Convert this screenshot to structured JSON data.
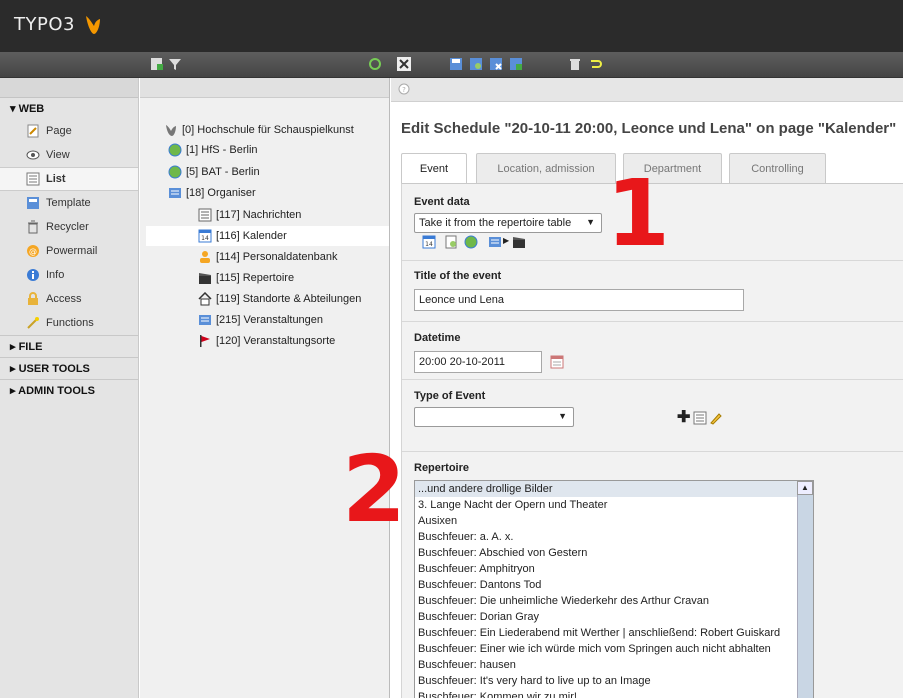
{
  "app": {
    "logo_text": "TYPO3"
  },
  "module_menu": {
    "sections": [
      {
        "label": "▾ WEB",
        "items": [
          {
            "label": "Page",
            "icon": "page-icon"
          },
          {
            "label": "View",
            "icon": "eye-icon"
          },
          {
            "label": "List",
            "icon": "list-icon",
            "active": true
          },
          {
            "label": "Template",
            "icon": "template-icon"
          },
          {
            "label": "Recycler",
            "icon": "trash-icon"
          },
          {
            "label": "Powermail",
            "icon": "powermail-icon"
          },
          {
            "label": "Info",
            "icon": "info-icon"
          },
          {
            "label": "Access",
            "icon": "lock-icon"
          },
          {
            "label": "Functions",
            "icon": "wand-icon"
          }
        ]
      },
      {
        "label": "▸ FILE"
      },
      {
        "label": "▸ USER TOOLS"
      },
      {
        "label": "▸ ADMIN TOOLS"
      }
    ]
  },
  "page_tree": {
    "nodes": [
      {
        "label": "[0] Hochschule für Schauspielkunst"
      },
      {
        "label": "[1] HfS - Berlin"
      },
      {
        "label": "[5] BAT - Berlin"
      },
      {
        "label": "[18] Organiser"
      },
      {
        "label": "[117] Nachrichten"
      },
      {
        "label": "[116] Kalender"
      },
      {
        "label": "[114] Personaldatenbank"
      },
      {
        "label": "[115] Repertoire"
      },
      {
        "label": "[119] Standorte & Abteilungen"
      },
      {
        "label": "[215] Veranstaltungen"
      },
      {
        "label": "[120] Veranstaltungsorte"
      }
    ]
  },
  "editor": {
    "title": "Edit Schedule \"20-10-11 20:00, Leonce und Lena\" on page \"Kalender\"",
    "tabs": [
      "Event",
      "Location, admission",
      "Department",
      "Controlling"
    ],
    "event_data": {
      "label": "Event data",
      "select_value": "Take it from the repertoire table"
    },
    "title_of_event": {
      "label": "Title of the event",
      "value": "Leonce und Lena"
    },
    "datetime": {
      "label": "Datetime",
      "value": "20:00 20-10-2011"
    },
    "type_of_event": {
      "label": "Type of Event",
      "select_value": ""
    },
    "repertoire": {
      "label": "Repertoire",
      "items": [
        "...und andere drollige Bilder",
        "3. Lange Nacht der Opern und Theater",
        "Ausixen",
        "Buschfeuer: a. A. x.",
        "Buschfeuer: Abschied von Gestern",
        "Buschfeuer: Amphitryon",
        "Buschfeuer: Dantons Tod",
        "Buschfeuer: Die unheimliche Wiederkehr des Arthur Cravan",
        "Buschfeuer: Dorian Gray",
        "Buschfeuer: Ein Liederabend mit Werther | anschließend: Robert Guiskard",
        "Buschfeuer: Einer wie ich würde mich vom Springen auch nicht abhalten",
        "Buschfeuer: hausen",
        "Buschfeuer: It's very hard to live up to an Image",
        "Buschfeuer: Kommen wir zu mir!"
      ]
    }
  },
  "annotations": {
    "one": "1",
    "two": "2"
  },
  "colors": {
    "accent_red": "#e8171a",
    "topbar": "#2b2b2b",
    "logo_orange": "#f49700"
  }
}
